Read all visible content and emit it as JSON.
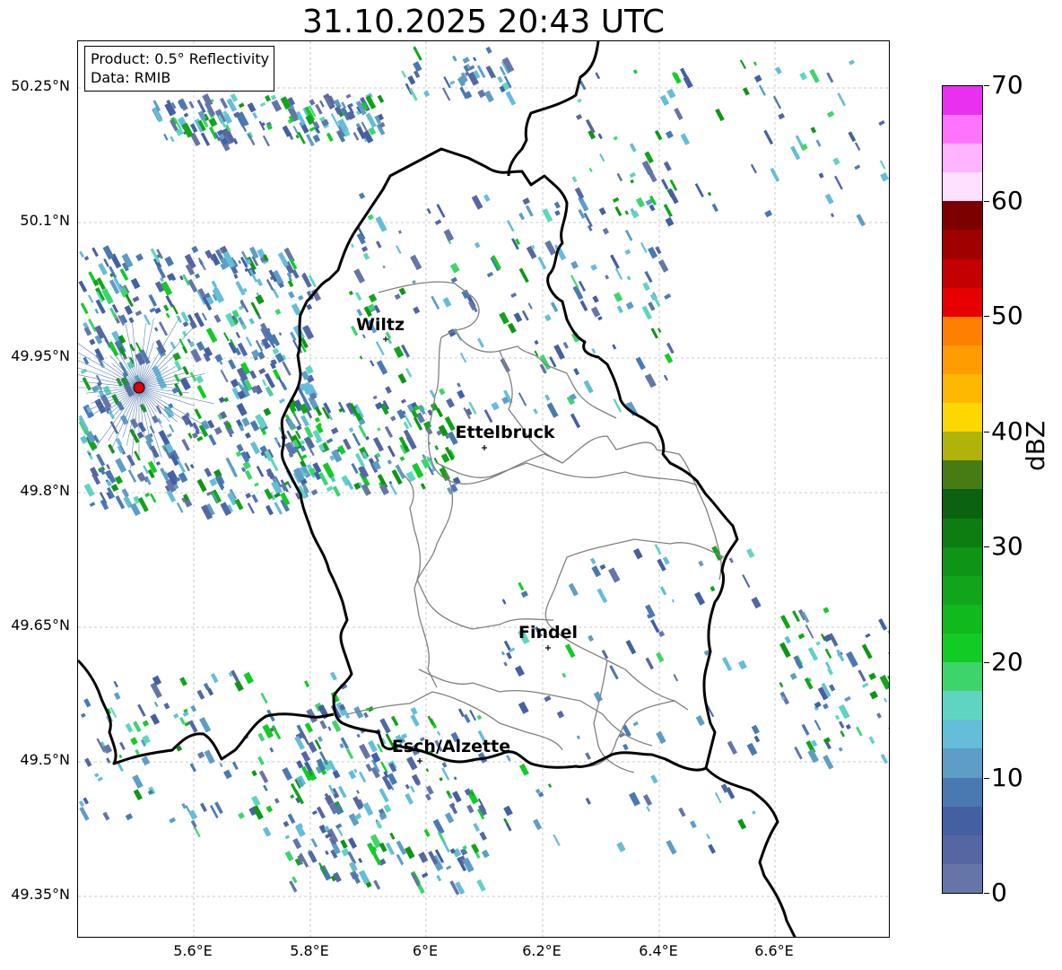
{
  "title": "31.10.2025 20:43 UTC",
  "info": {
    "product": "Product: 0.5° Reflectivity",
    "data": "Data: RMIB"
  },
  "axes": {
    "lat_ticks": [
      "50.25°N",
      "50.1°N",
      "49.95°N",
      "49.8°N",
      "49.65°N",
      "49.5°N",
      "49.35°N"
    ],
    "lon_ticks": [
      "5.6°E",
      "5.8°E",
      "6°E",
      "6.2°E",
      "6.4°E",
      "6.6°E"
    ]
  },
  "cities": [
    {
      "name": "Wiltz"
    },
    {
      "name": "Ettelbruck"
    },
    {
      "name": "Findel"
    },
    {
      "name": "Esch/Alzette"
    }
  ],
  "colorbar": {
    "label": "dBZ",
    "ticks": [
      "0",
      "10",
      "20",
      "30",
      "40",
      "50",
      "60",
      "70"
    ],
    "colors": [
      "#6575a8",
      "#5467a3",
      "#4460a3",
      "#4a79b2",
      "#5d9dc6",
      "#64bdd9",
      "#5fd5c1",
      "#3dd56b",
      "#12cc25",
      "#10b91d",
      "#10a51a",
      "#0f9516",
      "#0d7d12",
      "#0b6210",
      "#467c13",
      "#afb30a",
      "#ffd700",
      "#ffb800",
      "#ff9c00",
      "#ff7f00",
      "#e60000",
      "#c40000",
      "#a00000",
      "#7d0000",
      "#ffe0ff",
      "#ffb4ff",
      "#ff74ff",
      "#e830f0"
    ]
  },
  "radar_site": {
    "color": "#e00000"
  }
}
